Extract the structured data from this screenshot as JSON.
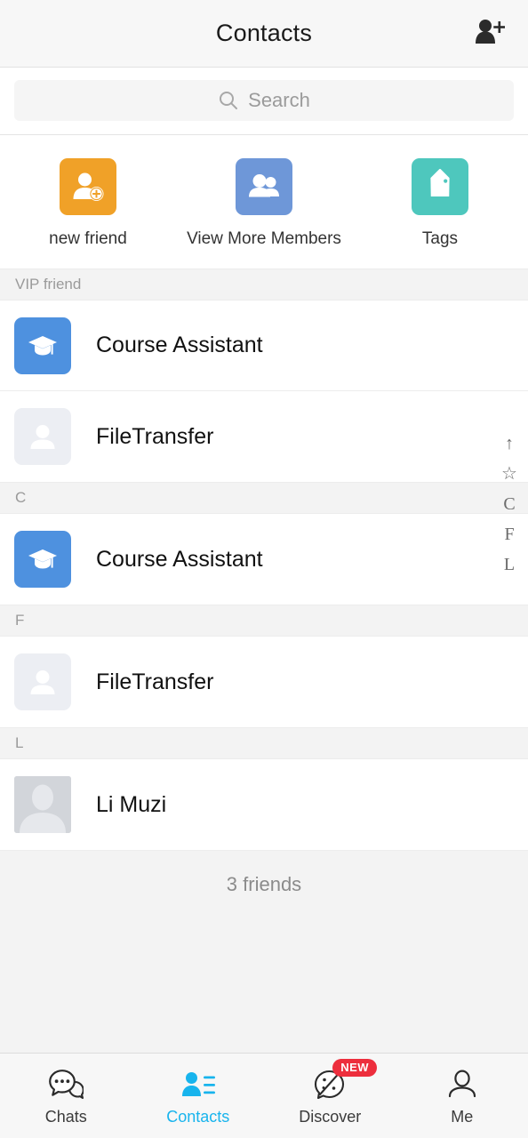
{
  "header": {
    "title": "Contacts",
    "add_contact_icon": "person-plus-icon"
  },
  "search": {
    "placeholder": "Search",
    "icon": "search-icon"
  },
  "shortcuts": [
    {
      "label": "new friend",
      "icon": "person-add-icon",
      "color": "#f0a128"
    },
    {
      "label": "View More Members",
      "icon": "group-people-icon",
      "color": "#6e97d8"
    },
    {
      "label": "Tags",
      "icon": "tag-icon",
      "color": "#4ec7bd"
    }
  ],
  "sections": [
    {
      "header": "VIP friend",
      "rows": [
        {
          "name": "Course Assistant",
          "avatar": "graduation-cap-avatar"
        },
        {
          "name": "FileTransfer",
          "avatar": "file-transfer-avatar"
        }
      ]
    },
    {
      "header": "C",
      "rows": [
        {
          "name": "Course Assistant",
          "avatar": "graduation-cap-avatar"
        }
      ]
    },
    {
      "header": "F",
      "rows": [
        {
          "name": "FileTransfer",
          "avatar": "file-transfer-avatar"
        }
      ]
    },
    {
      "header": "L",
      "rows": [
        {
          "name": "Li Muzi",
          "avatar": "person-silhouette-avatar"
        }
      ]
    }
  ],
  "footer": {
    "count_text": "3 friends"
  },
  "index_rail": [
    "↑",
    "☆",
    "C",
    "F",
    "L"
  ],
  "tabbar": {
    "active_color": "#18b4ed",
    "tabs": [
      {
        "label": "Chats",
        "icon": "chat-bubbles-icon",
        "active": false,
        "badge": ""
      },
      {
        "label": "Contacts",
        "icon": "contacts-person-icon",
        "active": true,
        "badge": ""
      },
      {
        "label": "Discover",
        "icon": "compass-icon",
        "active": false,
        "badge": "NEW"
      },
      {
        "label": "Me",
        "icon": "person-outline-icon",
        "active": false,
        "badge": ""
      }
    ]
  }
}
